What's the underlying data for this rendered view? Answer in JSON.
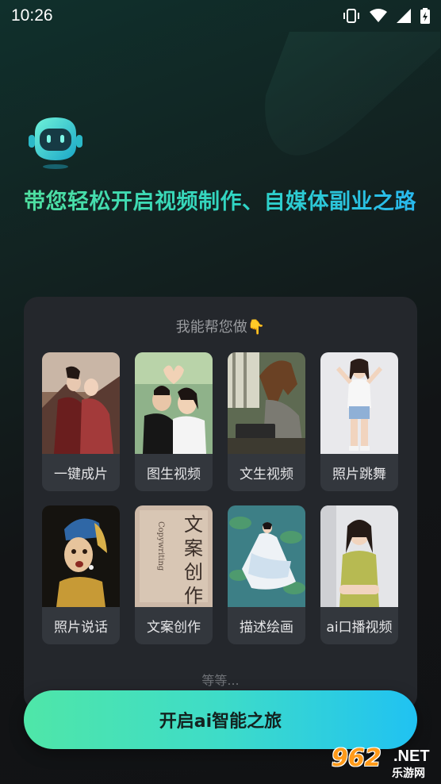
{
  "status_bar": {
    "time": "10:26",
    "icons": [
      "vibrate-icon",
      "wifi-icon",
      "signal-icon",
      "battery-charging-icon"
    ]
  },
  "hero": {
    "mascot": "robot-icon",
    "headline": "带您轻松开启视频制作、自媒体副业之路"
  },
  "panel": {
    "title": "我能帮您做",
    "title_icon": "pointing-down-hand-icon",
    "features": [
      {
        "label": "一键成片",
        "thumb": "costume-couple-photo"
      },
      {
        "label": "图生视频",
        "thumb": "heart-pose-couple-photo"
      },
      {
        "label": "文生视频",
        "thumb": "horse-at-computer-photo"
      },
      {
        "label": "照片跳舞",
        "thumb": "dancing-girl-photo"
      },
      {
        "label": "照片说话",
        "thumb": "pearl-earring-painting"
      },
      {
        "label": "文案创作",
        "thumb": "calligraphy-paper-photo"
      },
      {
        "label": "描述绘画",
        "thumb": "fairy-on-lotus-pond-painting"
      },
      {
        "label": "ai口播视频",
        "thumb": "presenter-woman-photo"
      }
    ],
    "more_text": "等等..."
  },
  "cta": {
    "label": "开启ai智能之旅"
  },
  "watermark": {
    "digits": "962",
    "suffix": ".NET",
    "cn": "乐游网"
  },
  "colors": {
    "accent_start": "#4fe6a8",
    "accent_end": "#20c2f2",
    "panel_bg": "#24272c",
    "card_bg": "#33373d"
  }
}
